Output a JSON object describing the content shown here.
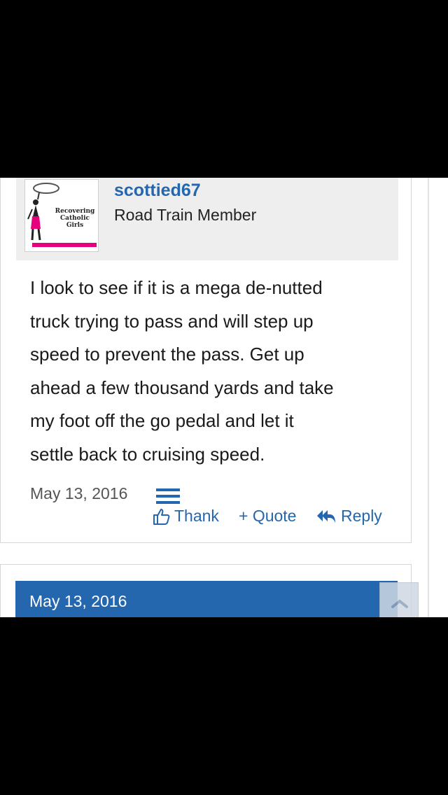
{
  "post": {
    "username": "scottied67",
    "user_title": "Road Train Member",
    "avatar_text": "Recovering\nCatholic\nGirls",
    "body_lines": [
      "I look to see if it is a mega de-nutted",
      "truck trying to pass and will step up",
      "speed to prevent the pass. Get up",
      "ahead a few thousand yards and take",
      "my foot off the go pedal and let it",
      "settle back to cruising speed."
    ],
    "date": "May 13, 2016",
    "actions": {
      "thank": "Thank",
      "quote": "+ Quote",
      "reply": "Reply"
    }
  },
  "next_post": {
    "date": "May 13, 2016"
  },
  "colors": {
    "link": "#2467ae",
    "header_bg": "#2467ae",
    "avatar_accent": "#e6007e"
  }
}
